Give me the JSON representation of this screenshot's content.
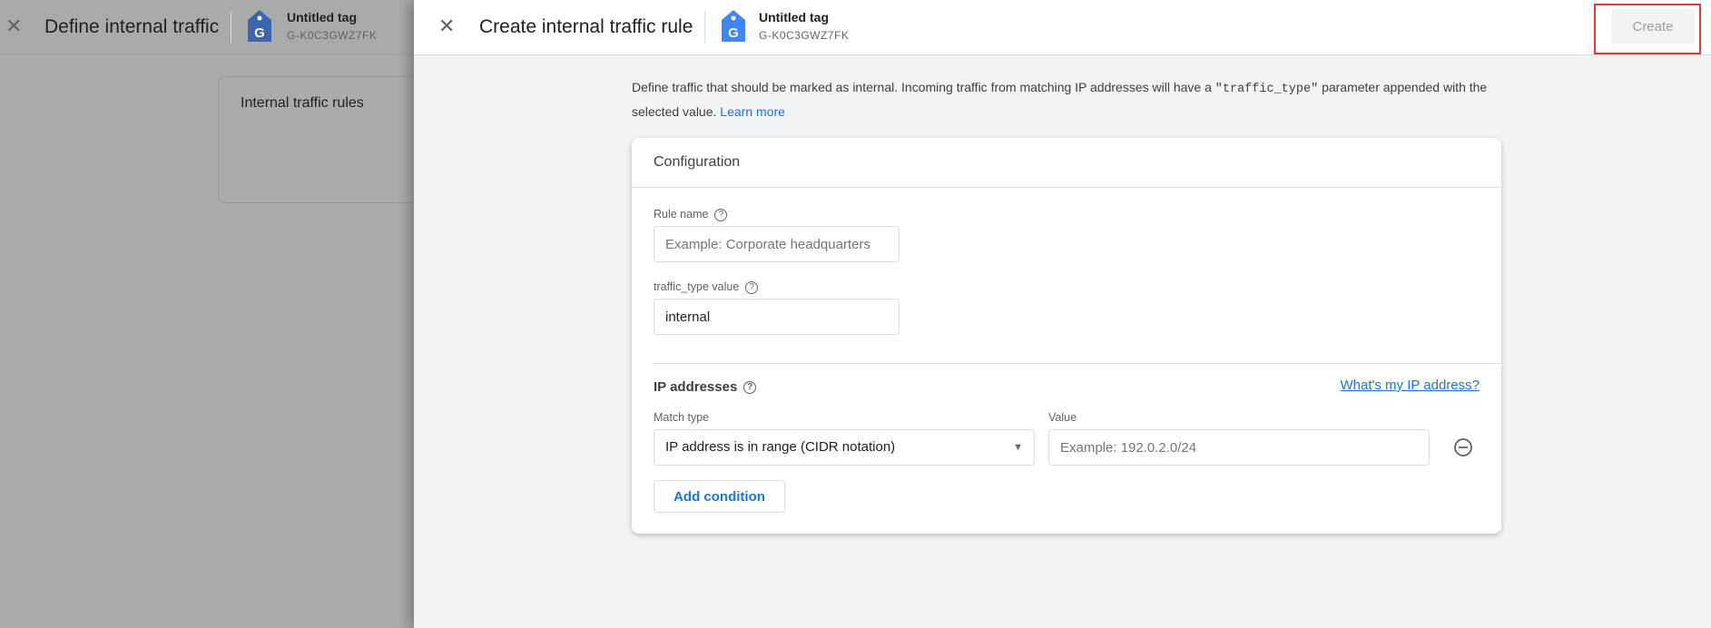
{
  "background_panel": {
    "title": "Define internal traffic",
    "tag_name": "Untitled tag",
    "tag_id": "G-K0C3GWZ7FK",
    "card_title": "Internal traffic rules"
  },
  "panel": {
    "title": "Create internal traffic rule",
    "tag_name": "Untitled tag",
    "tag_id": "G-K0C3GWZ7FK",
    "create_label": "Create",
    "description_before": "Define traffic that should be marked as internal. Incoming traffic from matching IP addresses will have a ",
    "description_code": "\"traffic_type\"",
    "description_after": " parameter appended with the selected value. ",
    "learn_more": "Learn more"
  },
  "configuration": {
    "title": "Configuration",
    "rule_name": {
      "label": "Rule name",
      "placeholder": "Example: Corporate headquarters",
      "value": ""
    },
    "traffic_type": {
      "label": "traffic_type value",
      "value": "internal"
    },
    "ip": {
      "title": "IP addresses",
      "whats_my_ip": "What's my IP address?",
      "match_type_label": "Match type",
      "match_type_value": "IP address is in range (CIDR notation)",
      "value_label": "Value",
      "value_placeholder": "Example: 192.0.2.0/24",
      "add_condition": "Add condition"
    }
  },
  "colors": {
    "accent": "#1a73e8",
    "highlight": "#e53935",
    "tag_icon": "#4285f4"
  }
}
